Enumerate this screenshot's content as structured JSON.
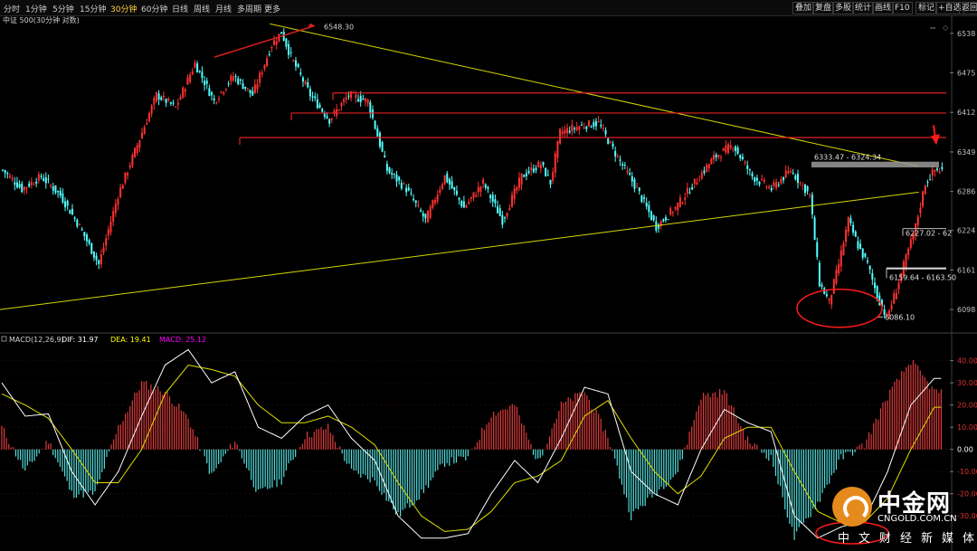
{
  "toolbar": {
    "timeframes": [
      "分时",
      "1分钟",
      "5分钟",
      "15分钟",
      "30分钟",
      "60分钟",
      "日线",
      "周线",
      "月线",
      "多周期",
      "更多"
    ],
    "active_timeframe": "30分钟",
    "right_buttons": [
      "叠加",
      "复盘",
      "多股",
      "统计",
      "画线",
      "F10",
      "标记",
      "+自选",
      "返回"
    ]
  },
  "chart_header": "中证 500(30分钟 对数)",
  "chart_data": [
    {
      "type": "candlestick",
      "title": "中证 500(30分钟 对数)",
      "y_ticks": [
        "6538",
        "6475",
        "6412",
        "6349",
        "6286",
        "6224",
        "6161",
        "6098"
      ],
      "ylim": [
        6065,
        6555
      ],
      "bull_color": "#ff3232",
      "bear_color": "#54ffff",
      "annotations": [
        {
          "label": "6548.30",
          "kind": "high",
          "value": 6548.3
        },
        {
          "label": "6333.47 - 6324.34",
          "kind": "zone",
          "low": 6324.34,
          "high": 6333.47
        },
        {
          "label": "6227.02 - 62",
          "kind": "zone",
          "low": 6224,
          "high": 6227.02
        },
        {
          "label": "6159.64 - 6163.50",
          "kind": "zone",
          "low": 6159.64,
          "high": 6163.5
        },
        {
          "label": "6086.10",
          "kind": "low",
          "value": 6086.1
        }
      ],
      "resistance_levels": [
        6443,
        6411,
        6372
      ],
      "trendlines": [
        {
          "name": "descending",
          "from": {
            "bar": 0.285,
            "value": 6553
          },
          "to": {
            "bar": 0.97,
            "value": 6326
          }
        },
        {
          "name": "ascending",
          "from": {
            "bar": 0.0,
            "value": 6098
          },
          "to": {
            "bar": 0.97,
            "value": 6285
          }
        }
      ],
      "anchor_closes": [
        [
          0,
          6320
        ],
        [
          8,
          6290
        ],
        [
          16,
          6310
        ],
        [
          24,
          6280
        ],
        [
          32,
          6230
        ],
        [
          40,
          6170
        ],
        [
          48,
          6280
        ],
        [
          56,
          6360
        ],
        [
          64,
          6440
        ],
        [
          72,
          6420
        ],
        [
          80,
          6490
        ],
        [
          88,
          6430
        ],
        [
          96,
          6470
        ],
        [
          104,
          6440
        ],
        [
          112,
          6520
        ],
        [
          116,
          6540
        ],
        [
          120,
          6500
        ],
        [
          128,
          6440
        ],
        [
          136,
          6400
        ],
        [
          144,
          6440
        ],
        [
          152,
          6430
        ],
        [
          160,
          6320
        ],
        [
          168,
          6290
        ],
        [
          176,
          6240
        ],
        [
          184,
          6310
        ],
        [
          192,
          6260
        ],
        [
          200,
          6300
        ],
        [
          208,
          6240
        ],
        [
          216,
          6310
        ],
        [
          224,
          6330
        ],
        [
          228,
          6300
        ],
        [
          232,
          6380
        ],
        [
          240,
          6390
        ],
        [
          248,
          6395
        ],
        [
          256,
          6340
        ],
        [
          264,
          6290
        ],
        [
          272,
          6230
        ],
        [
          280,
          6260
        ],
        [
          288,
          6300
        ],
        [
          296,
          6340
        ],
        [
          304,
          6360
        ],
        [
          312,
          6310
        ],
        [
          320,
          6290
        ],
        [
          328,
          6320
        ],
        [
          336,
          6280
        ],
        [
          340,
          6140
        ],
        [
          344,
          6110
        ],
        [
          348,
          6170
        ],
        [
          352,
          6240
        ],
        [
          356,
          6200
        ],
        [
          360,
          6170
        ],
        [
          364,
          6120
        ],
        [
          368,
          6085
        ],
        [
          372,
          6130
        ],
        [
          376,
          6180
        ],
        [
          380,
          6230
        ],
        [
          384,
          6300
        ],
        [
          388,
          6320
        ]
      ]
    },
    {
      "type": "bar+line",
      "title": "MACD(12,26,9)",
      "legend": [
        {
          "label": "DIF: 31.97",
          "color": "#ffffff"
        },
        {
          "label": "DEA: 19.41",
          "color": "#ffff00"
        },
        {
          "label": "MACD: 25.12",
          "color": "#ff00ff"
        }
      ],
      "y_ticks": [
        "40.00",
        "30.00",
        "20.00",
        "10.00",
        "0.00",
        "-10.00",
        "-20.00",
        "-30.00"
      ],
      "ylim": [
        -45,
        48
      ],
      "anchor_dif": [
        [
          0,
          30
        ],
        [
          10,
          15
        ],
        [
          20,
          16
        ],
        [
          30,
          -10
        ],
        [
          40,
          -25
        ],
        [
          50,
          -10
        ],
        [
          60,
          15
        ],
        [
          70,
          38
        ],
        [
          80,
          45
        ],
        [
          90,
          30
        ],
        [
          100,
          35
        ],
        [
          110,
          10
        ],
        [
          120,
          5
        ],
        [
          130,
          15
        ],
        [
          140,
          20
        ],
        [
          150,
          5
        ],
        [
          160,
          -5
        ],
        [
          170,
          -30
        ],
        [
          180,
          -40
        ],
        [
          190,
          -40
        ],
        [
          200,
          -38
        ],
        [
          210,
          -20
        ],
        [
          220,
          -5
        ],
        [
          230,
          -15
        ],
        [
          240,
          5
        ],
        [
          250,
          28
        ],
        [
          260,
          25
        ],
        [
          270,
          -10
        ],
        [
          280,
          -20
        ],
        [
          290,
          -25
        ],
        [
          300,
          0
        ],
        [
          310,
          18
        ],
        [
          320,
          12
        ],
        [
          330,
          8
        ],
        [
          340,
          -30
        ],
        [
          350,
          -40
        ],
        [
          360,
          -35
        ],
        [
          370,
          -32
        ],
        [
          380,
          -10
        ],
        [
          390,
          20
        ],
        [
          400,
          32
        ]
      ],
      "anchor_dea": [
        [
          0,
          25
        ],
        [
          10,
          20
        ],
        [
          20,
          14
        ],
        [
          30,
          0
        ],
        [
          40,
          -15
        ],
        [
          50,
          -15
        ],
        [
          60,
          0
        ],
        [
          70,
          25
        ],
        [
          80,
          38
        ],
        [
          90,
          36
        ],
        [
          100,
          33
        ],
        [
          110,
          20
        ],
        [
          120,
          12
        ],
        [
          130,
          12
        ],
        [
          140,
          15
        ],
        [
          150,
          10
        ],
        [
          160,
          2
        ],
        [
          170,
          -15
        ],
        [
          180,
          -30
        ],
        [
          190,
          -37
        ],
        [
          200,
          -36
        ],
        [
          210,
          -28
        ],
        [
          220,
          -15
        ],
        [
          230,
          -12
        ],
        [
          240,
          -5
        ],
        [
          250,
          15
        ],
        [
          260,
          22
        ],
        [
          270,
          5
        ],
        [
          280,
          -10
        ],
        [
          290,
          -20
        ],
        [
          300,
          -12
        ],
        [
          310,
          5
        ],
        [
          320,
          10
        ],
        [
          330,
          10
        ],
        [
          340,
          -10
        ],
        [
          350,
          -28
        ],
        [
          360,
          -33
        ],
        [
          370,
          -33
        ],
        [
          380,
          -22
        ],
        [
          390,
          0
        ],
        [
          400,
          19
        ]
      ]
    }
  ],
  "watermark": {
    "brand": "中金网",
    "url": "CNGOLD.COM.CN",
    "tagline": "中文财经新媒体"
  },
  "colors": {
    "background": "#000000",
    "bull": "#ff3232",
    "bear": "#54ffff",
    "trendline": "#d6d600",
    "resistance": "#e02020",
    "zone": "#9a9a9a",
    "circle": "#ff1a1a",
    "axis_text": "#c0c0c0"
  }
}
